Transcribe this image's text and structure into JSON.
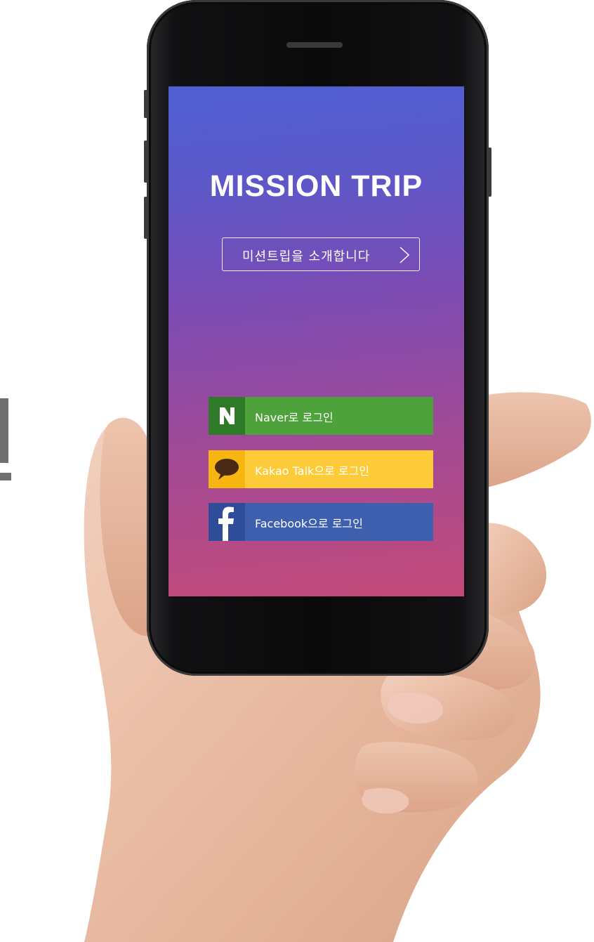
{
  "app": {
    "title": "MISSION TRIP",
    "intro_label": "미션트립을 소개합니다"
  },
  "login": {
    "naver_label": "Naver로 로그인",
    "kakao_label": "Kakao Talk으로 로그인",
    "facebook_label": "Facebook으로 로그인"
  },
  "icons": {
    "naver": "naver-n-icon",
    "kakao": "speech-bubble-icon",
    "facebook": "facebook-f-icon",
    "intro_chevron": "chevron-right-icon"
  },
  "colors": {
    "naver_green": "#4ea23c",
    "kakao_yellow": "#fdcb37",
    "facebook_blue": "#3d5fae",
    "gradient_top": "#4f5fd3",
    "gradient_bottom": "#c34a79"
  }
}
